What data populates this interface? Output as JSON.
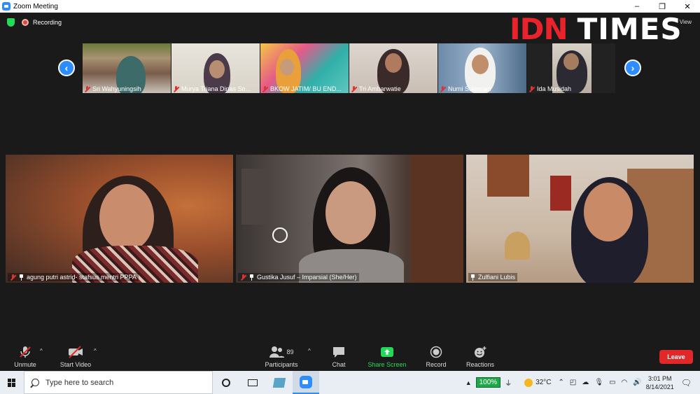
{
  "window": {
    "title": "Zoom Meeting",
    "minimize": "–",
    "restore": "❐",
    "close": "✕"
  },
  "meeting": {
    "recording_label": "Recording",
    "view_label": "View",
    "watermark_left": "IDN",
    "watermark_right": "TIMES"
  },
  "thumbnails": [
    {
      "name": "Sri Wahyuningsih"
    },
    {
      "name": "Murya Triana Dinas So..."
    },
    {
      "name": "BKOW JATIM/ BU END..."
    },
    {
      "name": "Tri Ambarwatie"
    },
    {
      "name": "Nurni Sulaiman"
    },
    {
      "name": "Ida Musidah"
    }
  ],
  "gallery": [
    {
      "name": "agung putri astrid- stafsus mentri PPPA"
    },
    {
      "name": "Gustika Jusuf – Imparsial (She/Her)"
    },
    {
      "name": "Zulfiani Lubis"
    }
  ],
  "toolbar": {
    "unmute": "Unmute",
    "start_video": "Start Video",
    "participants": "Participants",
    "participants_count": "89",
    "chat": "Chat",
    "share_screen": "Share Screen",
    "record": "Record",
    "reactions": "Reactions",
    "leave": "Leave",
    "caret": "^"
  },
  "taskbar": {
    "search_placeholder": "Type here to search",
    "battery": "100%",
    "weather": "32°C",
    "time": "3:01 PM",
    "date": "8/14/2021"
  }
}
